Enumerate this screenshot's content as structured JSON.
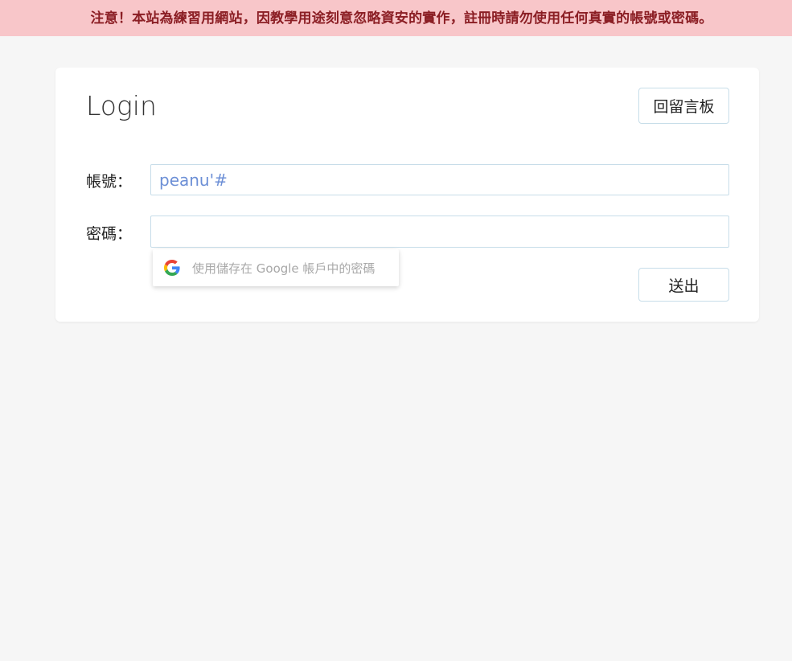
{
  "banner": {
    "text": "注意！本站為練習用網站，因教學用途刻意忽略資安的實作，註冊時請勿使用任何真實的帳號或密碼。"
  },
  "login": {
    "title": "Login",
    "back_button_label": "回留言板",
    "account_label": "帳號：",
    "account_value": "peanu'#",
    "password_label": "密碼：",
    "password_value": "",
    "submit_label": "送出"
  },
  "autofill": {
    "icon": "google-icon",
    "text": "使用儲存在 Google 帳戶中的密碼"
  },
  "colors": {
    "banner_bg": "#f8c6c9",
    "banner_text": "#8b1e24",
    "page_bg": "#f6f6f6",
    "input_text": "#6c8fd6",
    "border": "#c7dde9"
  }
}
